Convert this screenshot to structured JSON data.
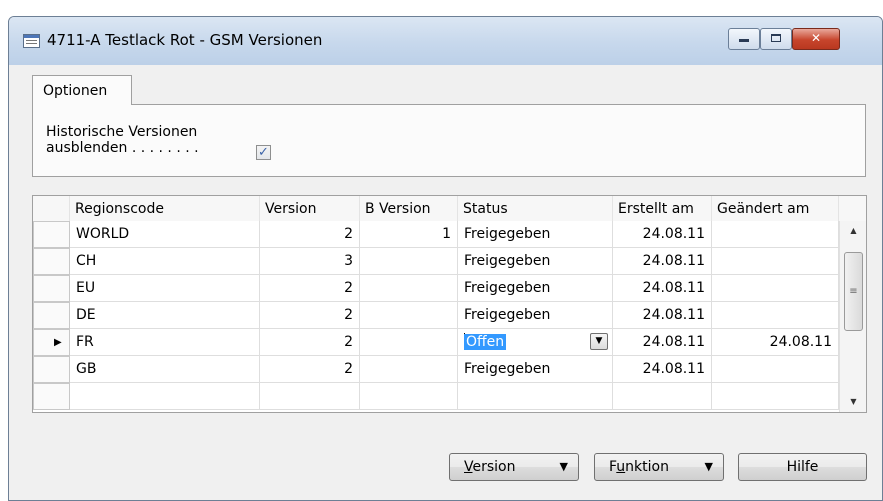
{
  "window": {
    "title": "4711-A Testlack Rot - GSM Versionen",
    "icons": {
      "app": "form-icon",
      "minimize": "minimize-icon",
      "maximize": "maximize-icon",
      "close": "close-icon"
    },
    "close_glyph": "✕"
  },
  "options_tab": {
    "label": "Optionen",
    "hide_historic_label_line1": "Historische Versionen",
    "hide_historic_label_line2": "ausblenden . . . . . . . .",
    "hide_historic_checked": true,
    "check_glyph": "✓"
  },
  "table": {
    "columns": [
      "Regionscode",
      "Version",
      "B Version",
      "Status",
      "Erstellt am",
      "Geändert am"
    ],
    "rows": [
      {
        "indicator": "",
        "region": "WORLD",
        "version": "2",
        "b_version": "1",
        "status": "Freigegeben",
        "created": "24.08.11",
        "changed": ""
      },
      {
        "indicator": "",
        "region": "CH",
        "version": "3",
        "b_version": "",
        "status": "Freigegeben",
        "created": "24.08.11",
        "changed": ""
      },
      {
        "indicator": "",
        "region": "EU",
        "version": "2",
        "b_version": "",
        "status": "Freigegeben",
        "created": "24.08.11",
        "changed": ""
      },
      {
        "indicator": "",
        "region": "DE",
        "version": "2",
        "b_version": "",
        "status": "Freigegeben",
        "created": "24.08.11",
        "changed": ""
      },
      {
        "indicator": "▶",
        "region": "FR",
        "version": "2",
        "b_version": "",
        "status": "Offen",
        "created": "24.08.11",
        "changed": "24.08.11"
      },
      {
        "indicator": "",
        "region": "GB",
        "version": "2",
        "b_version": "",
        "status": "Freigegeben",
        "created": "24.08.11",
        "changed": ""
      },
      {
        "indicator": "",
        "region": "",
        "version": "",
        "b_version": "",
        "status": "",
        "created": "",
        "changed": ""
      }
    ],
    "active_row_index": 4,
    "selection_color": "#3399ff"
  },
  "buttons": {
    "version": {
      "prefix": "",
      "underlined": "V",
      "rest": "ersion",
      "arrow": "▼"
    },
    "funktion": {
      "prefix": "F",
      "underlined": "u",
      "rest": "nktion",
      "arrow": "▼"
    },
    "hilfe": {
      "label": "Hilfe"
    }
  },
  "scrollbar": {
    "up": "▲",
    "down": "▼",
    "grip": "≡"
  }
}
